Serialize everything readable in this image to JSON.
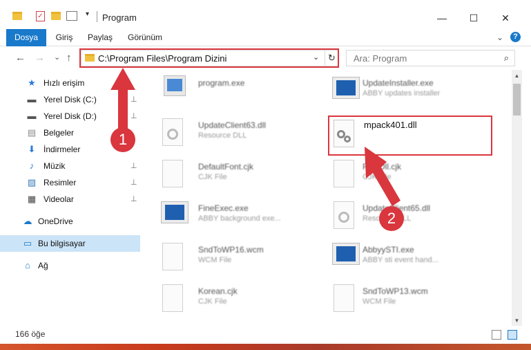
{
  "window": {
    "title": "Program",
    "controls": {
      "minimize": "—",
      "maximize": "☐",
      "close": "✕"
    }
  },
  "ribbon": {
    "tabs": [
      "Dosya",
      "Giriş",
      "Paylaş",
      "Görünüm"
    ],
    "help": "?",
    "expand": "⌄"
  },
  "nav": {
    "back": "←",
    "forward": "→",
    "recent": "⌄",
    "up": "↑",
    "address": "C:\\Program Files\\Program Dizini",
    "address_dropdown": "⌄",
    "refresh": "↻",
    "search_placeholder": "Ara: Program",
    "search_icon": "⌕"
  },
  "sidebar": {
    "items": [
      {
        "label": "Hızlı erişim",
        "icon": "★",
        "pinned": false
      },
      {
        "label": "Yerel Disk (C:)",
        "icon": "▬",
        "pinned": true
      },
      {
        "label": "Yerel Disk (D:)",
        "icon": "▬",
        "pinned": true
      },
      {
        "label": "Belgeler",
        "icon": "▤",
        "pinned": true
      },
      {
        "label": "İndirmeler",
        "icon": "⬇",
        "pinned": true
      },
      {
        "label": "Müzik",
        "icon": "♪",
        "pinned": true
      },
      {
        "label": "Resimler",
        "icon": "▨",
        "pinned": true
      },
      {
        "label": "Videolar",
        "icon": "▦",
        "pinned": true
      },
      {
        "label": "OneDrive",
        "icon": "☁",
        "pinned": false
      },
      {
        "label": "Bu bilgisayar",
        "icon": "▭",
        "pinned": false
      },
      {
        "label": "Ağ",
        "icon": "⌂",
        "pinned": false
      }
    ],
    "pin_glyph": "📌"
  },
  "files": [
    {
      "name": "program.exe",
      "type": ""
    },
    {
      "name": "UpdateInstaller.exe",
      "type": "ABBY updates installer"
    },
    {
      "name": "UpdateClient63.dll",
      "type": "Resource DLL"
    },
    {
      "name": "mpack401.dll",
      "type": ""
    },
    {
      "name": "DefaultFont.cjk",
      "type": "CJK File"
    },
    {
      "name": "FontDll.cjk",
      "type": "CJK File"
    },
    {
      "name": "FineExec.exe",
      "type": "ABBY background exe..."
    },
    {
      "name": "UpdateClient65.dll",
      "type": "Resource DLL"
    },
    {
      "name": "SndToWP16.wcm",
      "type": "WCM File"
    },
    {
      "name": "AbbyySTI.exe",
      "type": "ABBY sti event hand..."
    },
    {
      "name": "Korean.cjk",
      "type": "CJK File"
    },
    {
      "name": "SndToWP13.wcm",
      "type": "WCM File"
    }
  ],
  "status": {
    "count": "166 öğe"
  },
  "annotations": {
    "step1": "1",
    "step2": "2",
    "color": "#d9363e"
  },
  "colors": {
    "accent": "#1979ca",
    "folder": "#f0c23f",
    "selected": "#cce4f7"
  }
}
